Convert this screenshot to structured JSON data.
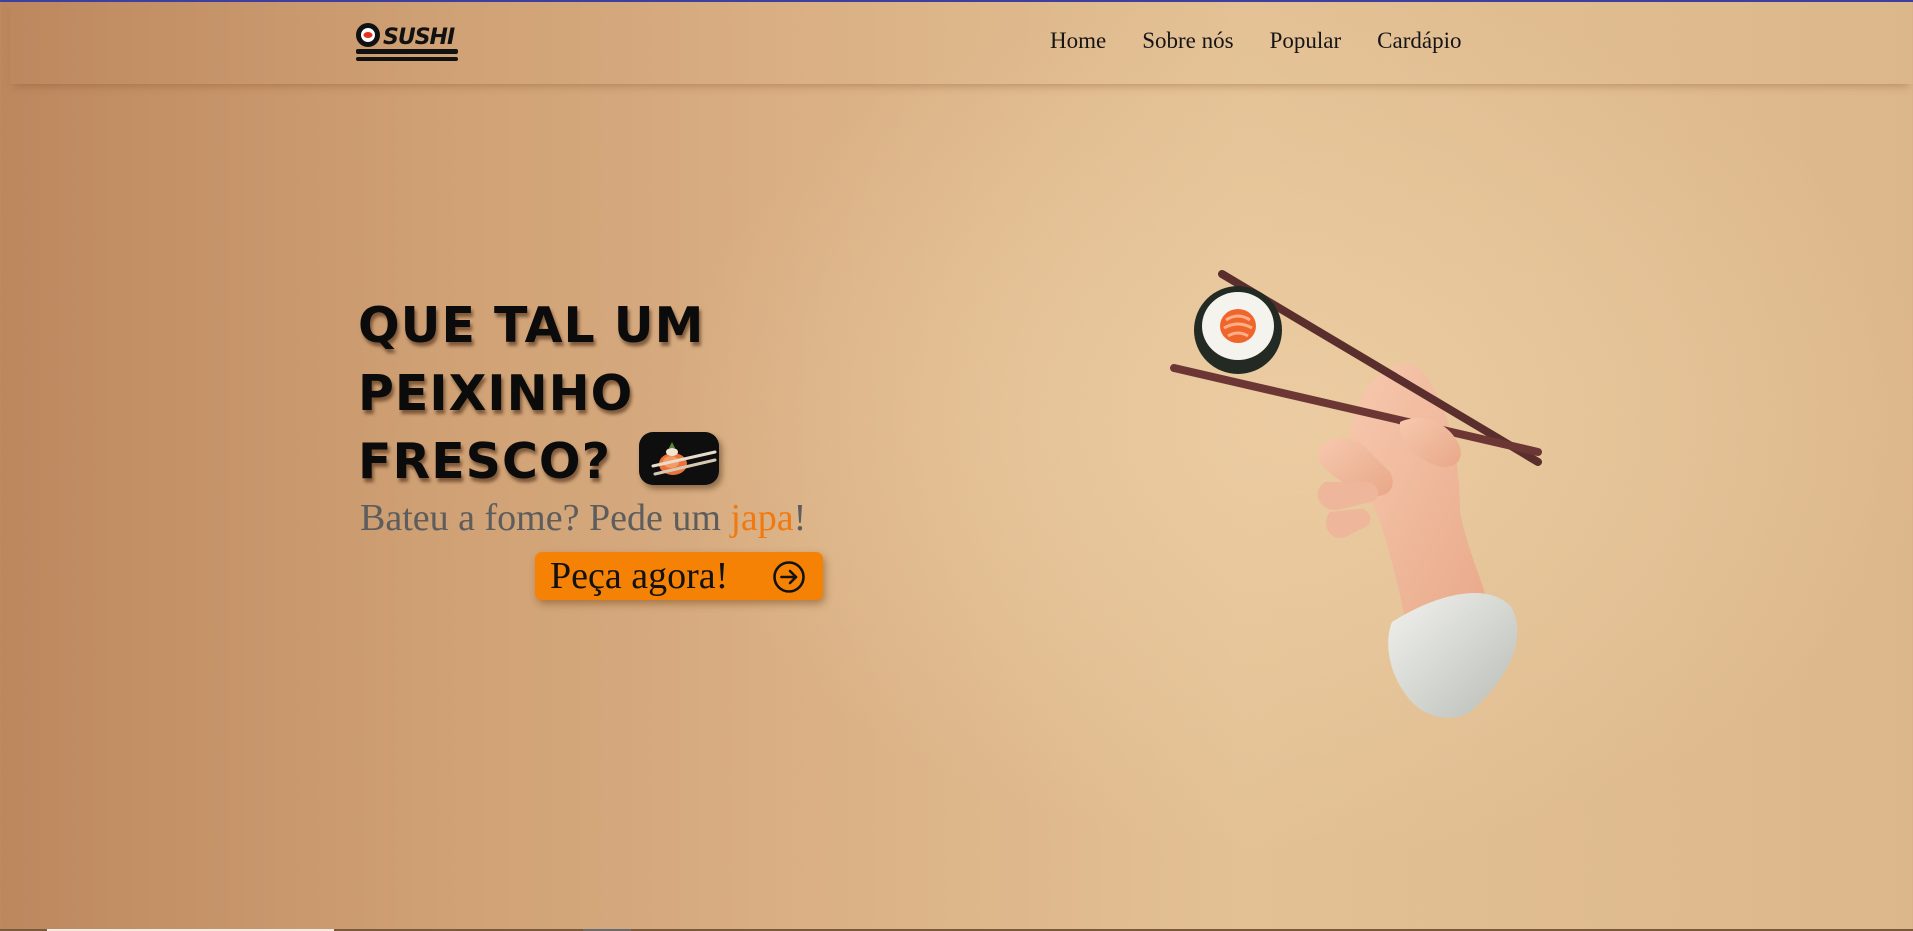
{
  "header": {
    "logo_text": "SUSHI",
    "nav": [
      {
        "label": "Home"
      },
      {
        "label": "Sobre nós"
      },
      {
        "label": "Popular"
      },
      {
        "label": "Cardápio"
      }
    ]
  },
  "hero": {
    "title_lines": [
      "QUE TAL UM",
      "PEIXINHO",
      "FRESCO?"
    ],
    "subtitle_before": "Bateu a fome? Pede um ",
    "subtitle_accent": "japa",
    "subtitle_after": "!",
    "cta_label": "Peça agora!",
    "cta_icon": "arrow-right-circle-icon",
    "badge_icon": "sushi-chopsticks-icon",
    "illustration": "hand-chopsticks-sushi-illustration"
  },
  "colors": {
    "accent": "#f58205",
    "accent_text": "#f07a10",
    "title": "#0b0b0b",
    "subtitle": "#5d5d5d"
  }
}
